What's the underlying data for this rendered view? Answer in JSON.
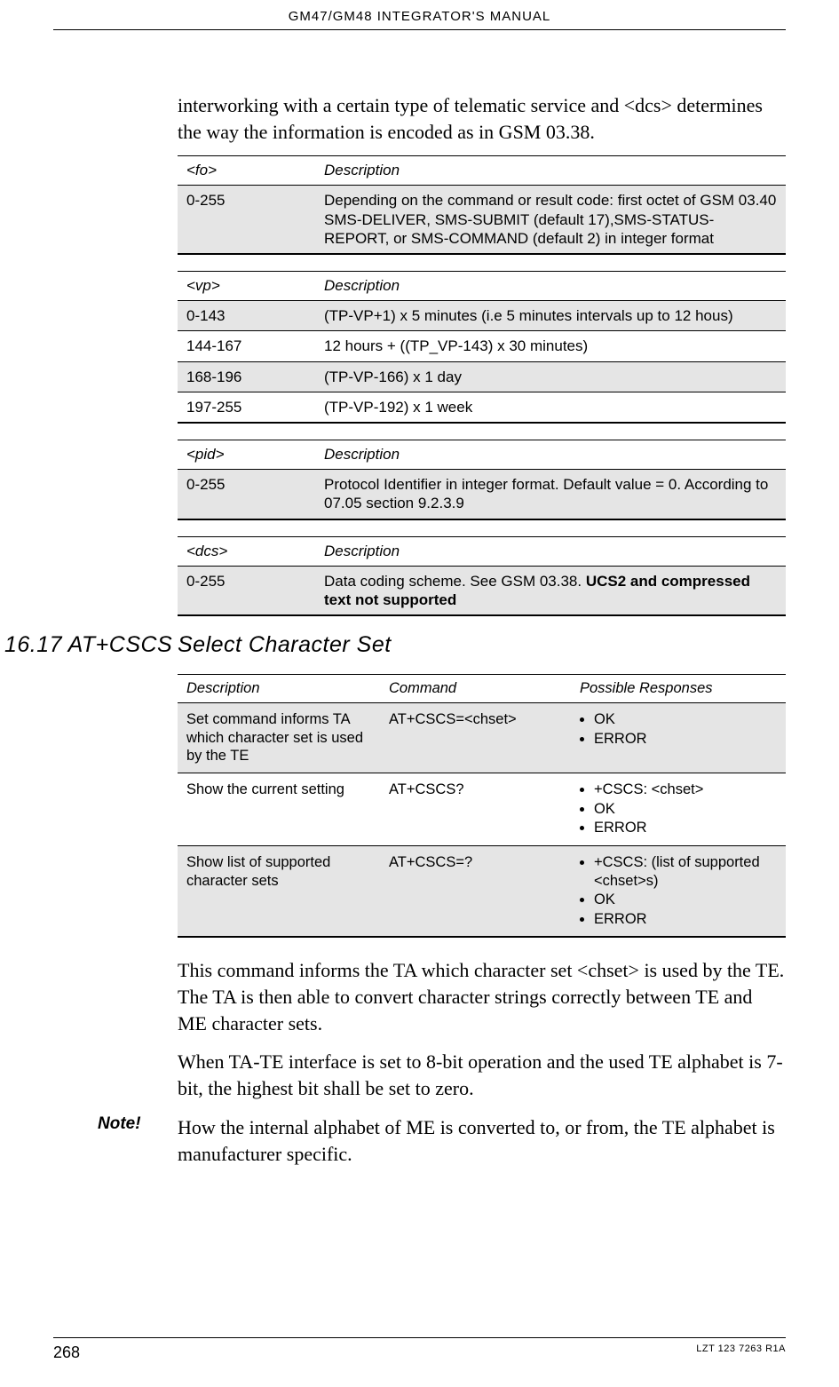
{
  "header": {
    "title": "GM47/GM48 INTEGRATOR'S MANUAL"
  },
  "intro": "interworking with a certain type of telematic service and <dcs> determines the way the information is encoded as in GSM 03.38.",
  "tables": {
    "fo": {
      "head": {
        "k": "<fo>",
        "d": "Description"
      },
      "rows": [
        {
          "k": "0-255",
          "d": "Depending on the command or result code: first octet of GSM 03.40 SMS-DELIVER, SMS-SUBMIT (default 17),SMS-STATUS-REPORT, or SMS-COMMAND (default 2) in integer format",
          "shade": true
        }
      ]
    },
    "vp": {
      "head": {
        "k": "<vp>",
        "d": "Description"
      },
      "rows": [
        {
          "k": "0-143",
          "d": "(TP-VP+1) x 5 minutes (i.e 5 minutes intervals up to 12 hous)",
          "shade": true
        },
        {
          "k": "144-167",
          "d": "12 hours + ((TP_VP-143) x 30 minutes)",
          "shade": false
        },
        {
          "k": "168-196",
          "d": "(TP-VP-166) x 1 day",
          "shade": true
        },
        {
          "k": "197-255",
          "d": "(TP-VP-192) x 1 week",
          "shade": false
        }
      ]
    },
    "pid": {
      "head": {
        "k": "<pid>",
        "d": "Description"
      },
      "rows": [
        {
          "k": "0-255",
          "d": "Protocol Identifier in integer format. Default value = 0. According to 07.05 section 9.2.3.9",
          "shade": true
        }
      ]
    },
    "dcs": {
      "head": {
        "k": "<dcs>",
        "d": "Description"
      },
      "rows": [
        {
          "k": "0-255",
          "d_prefix": "Data coding scheme. See GSM 03.38. ",
          "d_bold": "UCS2 and compressed text not supported",
          "shade": true
        }
      ]
    }
  },
  "section": {
    "num": "16.17 AT+CSCS",
    "title": "Select Character Set"
  },
  "cmd_table": {
    "head": {
      "c1": "Description",
      "c2": "Command",
      "c3": "Possible Responses"
    },
    "rows": [
      {
        "c1": "Set command informs TA which character set is used by the TE",
        "c2": "AT+CSCS=<chset>",
        "resp": [
          "OK",
          "ERROR"
        ],
        "shade": true
      },
      {
        "c1": "Show the current setting",
        "c2": "AT+CSCS?",
        "resp": [
          "+CSCS: <chset>",
          "OK",
          "ERROR"
        ],
        "shade": false
      },
      {
        "c1": "Show list of supported character sets",
        "c2": "AT+CSCS=?",
        "resp": [
          "+CSCS: (list of supported <chset>s)",
          "OK",
          "ERROR"
        ],
        "shade": true
      }
    ]
  },
  "body": {
    "p1": "This command informs the TA which character set <chset> is used by the TE. The TA is then able to convert character strings correctly between TE and ME character sets.",
    "p2": "When TA-TE interface is set to 8-bit operation and the used TE alphabet is 7-bit, the highest bit shall be set to zero.",
    "note_label": "Note!",
    "note": "How the internal alphabet of ME is converted to, or from, the TE alphabet is manufacturer specific."
  },
  "footer": {
    "page": "268",
    "doc_id": "LZT 123 7263 R1A"
  }
}
